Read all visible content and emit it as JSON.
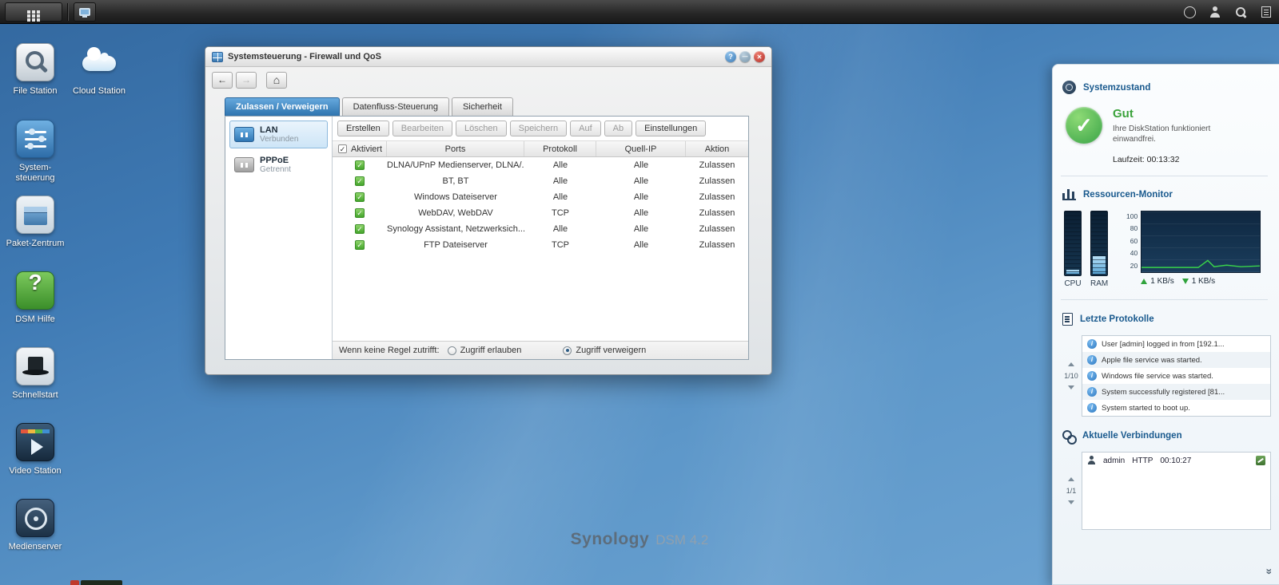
{
  "taskbar": {
    "left_icons": [
      "main-menu-grid",
      "show-desktop"
    ],
    "right_icons": [
      "info",
      "user",
      "search",
      "widgets-toggle"
    ]
  },
  "desktop": {
    "row_icons": [
      {
        "label": "File Station",
        "kind": "file-station"
      },
      {
        "label": "Cloud Station",
        "kind": "cloud-station"
      }
    ],
    "column_icons": [
      {
        "label": "System-steuerung",
        "kind": "control-panel"
      },
      {
        "label": "Paket-Zentrum",
        "kind": "package-center"
      },
      {
        "label": "DSM Hilfe",
        "kind": "help"
      },
      {
        "label": "Schnellstart",
        "kind": "quickstart"
      },
      {
        "label": "Video Station",
        "kind": "video-station"
      },
      {
        "label": "Medienserver",
        "kind": "media-server"
      }
    ],
    "branding": {
      "name": "Synology",
      "version": "DSM 4.2"
    }
  },
  "window": {
    "title": "Systemsteuerung - Firewall und QoS",
    "tabs": [
      {
        "label": "Zulassen / Verweigern",
        "active": true
      },
      {
        "label": "Datenfluss-Steuerung",
        "active": false
      },
      {
        "label": "Sicherheit",
        "active": false
      }
    ],
    "interfaces": [
      {
        "name": "LAN",
        "status": "Verbunden",
        "kind": "lan",
        "selected": true
      },
      {
        "name": "PPPoE",
        "status": "Getrennt",
        "kind": "pppoe",
        "selected": false
      }
    ],
    "toolbar": [
      {
        "label": "Erstellen",
        "enabled": true
      },
      {
        "label": "Bearbeiten",
        "enabled": false
      },
      {
        "label": "Löschen",
        "enabled": false
      },
      {
        "label": "Speichern",
        "enabled": false
      },
      {
        "label": "Auf",
        "enabled": false
      },
      {
        "label": "Ab",
        "enabled": false
      },
      {
        "label": "Einstellungen",
        "enabled": true
      }
    ],
    "table": {
      "columns": [
        "Aktiviert",
        "Ports",
        "Protokoll",
        "Quell-IP",
        "Aktion"
      ],
      "rows": [
        {
          "enabled": true,
          "ports": "DLNA/UPnP Medienserver, DLNA/...",
          "protokoll": "Alle",
          "quell_ip": "Alle",
          "aktion": "Zulassen"
        },
        {
          "enabled": true,
          "ports": "BT, BT",
          "protokoll": "Alle",
          "quell_ip": "Alle",
          "aktion": "Zulassen"
        },
        {
          "enabled": true,
          "ports": "Windows Dateiserver",
          "protokoll": "Alle",
          "quell_ip": "Alle",
          "aktion": "Zulassen"
        },
        {
          "enabled": true,
          "ports": "WebDAV, WebDAV",
          "protokoll": "TCP",
          "quell_ip": "Alle",
          "aktion": "Zulassen"
        },
        {
          "enabled": true,
          "ports": "Synology Assistant, Netzwerksich...",
          "protokoll": "Alle",
          "quell_ip": "Alle",
          "aktion": "Zulassen"
        },
        {
          "enabled": true,
          "ports": "FTP Dateiserver",
          "protokoll": "TCP",
          "quell_ip": "Alle",
          "aktion": "Zulassen"
        }
      ]
    },
    "default_rule": {
      "label": "Wenn keine Regel zutrifft:",
      "options": [
        {
          "label": "Zugriff erlauben",
          "selected": false
        },
        {
          "label": "Zugriff verweigern",
          "selected": true
        }
      ]
    }
  },
  "widgets": {
    "system_health": {
      "title": "Systemzustand",
      "status": "Gut",
      "description": "Ihre DiskStation funktioniert einwandfrei.",
      "uptime": "Laufzeit: 00:13:32"
    },
    "resource_monitor": {
      "title": "Ressourcen-Monitor",
      "cpu_label": "CPU",
      "ram_label": "RAM",
      "cpu_percent": 6,
      "ram_percent": 28,
      "scale": [
        "100",
        "80",
        "60",
        "40",
        "20"
      ],
      "upload": "1 KB/s",
      "download": "1 KB/s"
    },
    "logs": {
      "title": "Letzte Protokolle",
      "page": "1/10",
      "entries": [
        {
          "text": "User [admin] logged in from [192.1..."
        },
        {
          "text": "Apple file service was started."
        },
        {
          "text": "Windows file service was started."
        },
        {
          "text": "System successfully registered [81..."
        },
        {
          "text": "System started to boot up."
        }
      ]
    },
    "connections": {
      "title": "Aktuelle Verbindungen",
      "page": "1/1",
      "entries": [
        {
          "user": "admin",
          "protocol": "HTTP",
          "time": "00:10:27"
        }
      ]
    }
  }
}
